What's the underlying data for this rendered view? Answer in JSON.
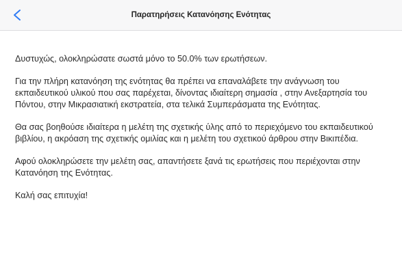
{
  "nav": {
    "back_icon": "chevron-left-icon",
    "title": "Παρατηρήσεις Κατανόησης Ενότητας",
    "accent_color": "#2f7bf5"
  },
  "content": {
    "paragraphs": [
      "Δυστυχώς, ολοκληρώσατε σωστά μόνο το 50.0% των ερωτήσεων.",
      "Για την πλήρη κατανόηση της ενότητας θα πρέπει να επαναλάβετε την ανάγνωση του εκπαιδευτικού υλικού που σας παρέχεται, δίνοντας ιδιαίτερη σημασία , στην Ανεξαρτησία του Πόντου, στην Μικρασιατική εκστρατεία, στα τελικά Συμπεράσματα της Ενότητας.",
      "Θα σας βοηθούσε ιδιαίτερα η μελέτη της σχετικής ύλης από το περιεχόμενο του εκπαιδευτικού βιβλίου, η ακρόαση της σχετικής ομιλίας και η μελέτη του σχετικού άρθρου στην Βικιπέδια.",
      "Αφού ολοκληρώσετε την μελέτη σας, απαντήσετε ξανά τις ερωτήσεις που περιέχονται στην Κατανόηση της Ενότητας.",
      "Καλή σας επιτυχία!"
    ]
  }
}
